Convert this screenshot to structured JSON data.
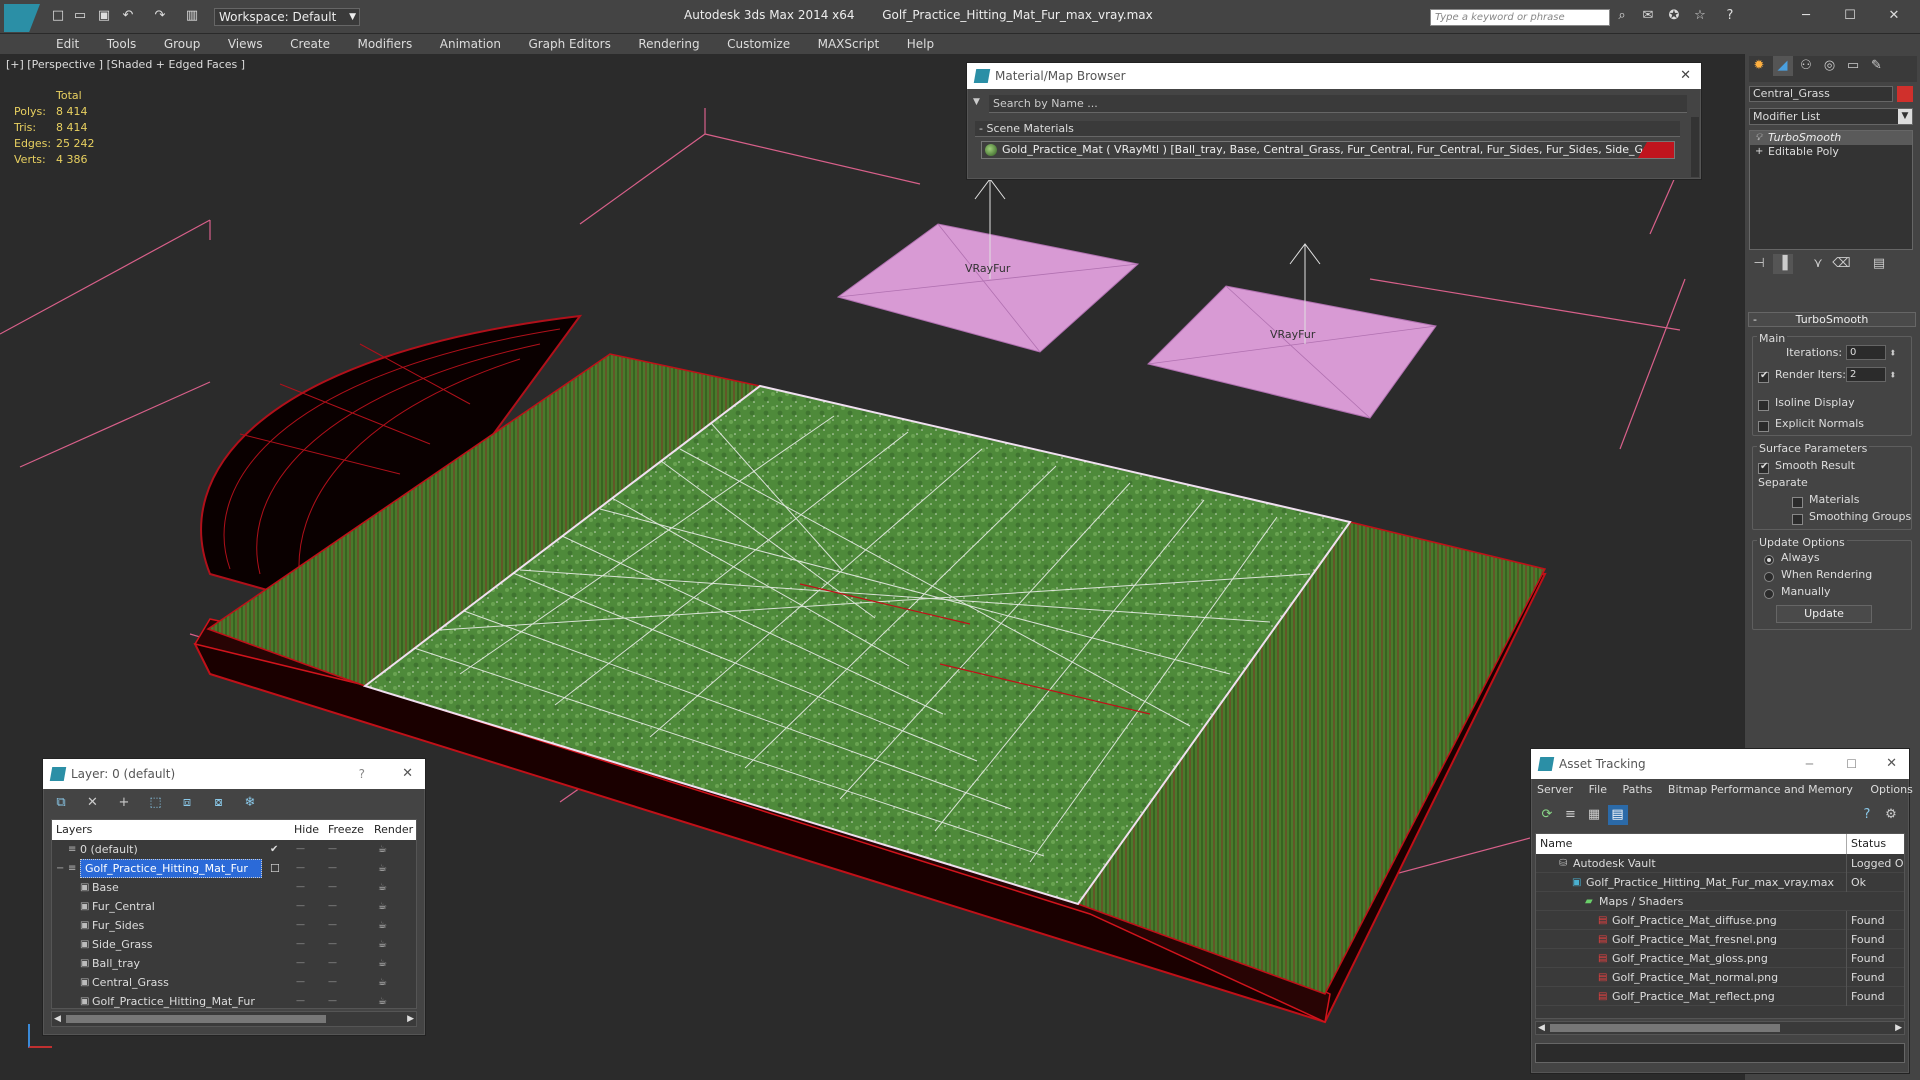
{
  "app": {
    "title": "Autodesk 3ds Max  2014 x64",
    "file": "Golf_Practice_Hitting_Mat_Fur_max_vray.max",
    "workspace": "Workspace: Default",
    "search_placeholder": "Type a keyword or phrase"
  },
  "menu": [
    "Edit",
    "Tools",
    "Group",
    "Views",
    "Create",
    "Modifiers",
    "Animation",
    "Graph Editors",
    "Rendering",
    "Customize",
    "MAXScript",
    "Help"
  ],
  "viewport": {
    "label": "[+] [Perspective ] [Shaded + Edged Faces ]",
    "stats": {
      "header": "Total",
      "rows": [
        {
          "k": "Polys:",
          "v": "8 414"
        },
        {
          "k": "Tris:",
          "v": "8 414"
        },
        {
          "k": "Edges:",
          "v": "25 242"
        },
        {
          "k": "Verts:",
          "v": "4 386"
        }
      ]
    },
    "fur_label_1": "VRayFur",
    "fur_label_2": "VRayFur"
  },
  "material_browser": {
    "title": "Material/Map Browser",
    "search_placeholder": "Search by Name ...",
    "section": "- Scene Materials",
    "item": "Gold_Practice_Mat  ( VRayMtl ) [Ball_tray, Base, Central_Grass, Fur_Central, Fur_Central, Fur_Sides, Fur_Sides, Side_Grass]",
    "swatch_color": "#c0141e"
  },
  "command_panel": {
    "object_name": "Central_Grass",
    "object_color": "#d0302c",
    "modifier_list": "Modifier List",
    "stack": [
      "TurboSmooth",
      "Editable Poly"
    ],
    "rollout_title": "TurboSmooth",
    "main_group": "Main",
    "iterations_label": "Iterations:",
    "iterations_value": "0",
    "render_iters_label": "Render Iters:",
    "render_iters_value": "2",
    "render_iters_checked": true,
    "isoline_label": "Isoline Display",
    "explicit_label": "Explicit Normals",
    "surface_group": "Surface Parameters",
    "smooth_result_label": "Smooth Result",
    "separate_label": "Separate",
    "materials_label": "Materials",
    "smoothing_groups_label": "Smoothing Groups",
    "update_group": "Update Options",
    "always_label": "Always",
    "when_rendering_label": "When Rendering",
    "manually_label": "Manually",
    "update_button": "Update"
  },
  "layer_window": {
    "title": "Layer: 0 (default)",
    "question": "?",
    "columns": [
      "Layers",
      "Hide",
      "Freeze",
      "Render"
    ],
    "rows": [
      {
        "name": "0 (default)",
        "indent": 1,
        "selected": false
      },
      {
        "name": "Golf_Practice_Hitting_Mat_Fur",
        "indent": 1,
        "selected": true
      },
      {
        "name": "Base",
        "indent": 2,
        "selected": false
      },
      {
        "name": "Fur_Central",
        "indent": 2,
        "selected": false
      },
      {
        "name": "Fur_Sides",
        "indent": 2,
        "selected": false
      },
      {
        "name": "Side_Grass",
        "indent": 2,
        "selected": false
      },
      {
        "name": "Ball_tray",
        "indent": 2,
        "selected": false
      },
      {
        "name": "Central_Grass",
        "indent": 2,
        "selected": false
      },
      {
        "name": "Golf_Practice_Hitting_Mat_Fur",
        "indent": 2,
        "selected": false
      }
    ]
  },
  "asset_tracking": {
    "title": "Asset Tracking",
    "menu": [
      "Server",
      "File",
      "Paths",
      "Bitmap Performance and Memory",
      "Options"
    ],
    "col_name": "Name",
    "col_status": "Status",
    "rows": [
      {
        "name": "Autodesk Vault",
        "status": "Logged Ou",
        "indent": 1,
        "icon": "vault"
      },
      {
        "name": "Golf_Practice_Hitting_Mat_Fur_max_vray.max",
        "status": "Ok",
        "indent": 2,
        "icon": "max"
      },
      {
        "name": "Maps / Shaders",
        "status": "",
        "indent": 3,
        "icon": "maps"
      },
      {
        "name": "Golf_Practice_Mat_diffuse.png",
        "status": "Found",
        "indent": 4,
        "icon": "png"
      },
      {
        "name": "Golf_Practice_Mat_fresnel.png",
        "status": "Found",
        "indent": 4,
        "icon": "png"
      },
      {
        "name": "Golf_Practice_Mat_gloss.png",
        "status": "Found",
        "indent": 4,
        "icon": "png"
      },
      {
        "name": "Golf_Practice_Mat_normal.png",
        "status": "Found",
        "indent": 4,
        "icon": "png"
      },
      {
        "name": "Golf_Practice_Mat_reflect.png",
        "status": "Found",
        "indent": 4,
        "icon": "png"
      }
    ]
  }
}
